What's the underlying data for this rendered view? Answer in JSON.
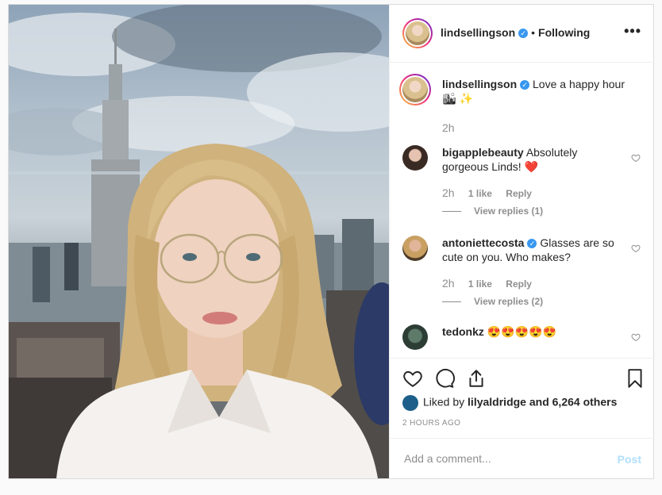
{
  "author": {
    "username": "lindsellingson",
    "verified": true,
    "follow_status": "Following",
    "more_icon": "more-horizontal-icon"
  },
  "caption": {
    "username": "lindsellingson",
    "text": "Love a happy hour",
    "emojis": "🏙 ✨",
    "time": "2h"
  },
  "comments": [
    {
      "username": "bigapplebeauty",
      "text": "Absolutely gorgeous Linds! ❤️",
      "time": "2h",
      "likes": "1 like",
      "reply_label": "Reply",
      "view_replies": "View replies (1)"
    },
    {
      "username": "antoniettecosta",
      "verified": true,
      "text": "Glasses are so cute on you. Who makes?",
      "time": "2h",
      "likes": "1 like",
      "reply_label": "Reply",
      "view_replies": "View replies (2)"
    },
    {
      "username": "tedonkz",
      "text": "😍😍😍😍😍"
    }
  ],
  "actions": {
    "like_icon": "heart-icon",
    "comment_icon": "comment-icon",
    "share_icon": "share-icon",
    "save_icon": "bookmark-icon"
  },
  "likes": {
    "prefix": "Liked by",
    "user": "lilyaldridge",
    "suffix": "and 6,264 others"
  },
  "timestamp": "2 HOURS AGO",
  "add_comment": {
    "placeholder": "Add a comment...",
    "post_label": "Post"
  },
  "colors": {
    "verified_blue": "#3897f0",
    "post_button_disabled": "#b2dffc",
    "heart_red": "#ed4956"
  }
}
